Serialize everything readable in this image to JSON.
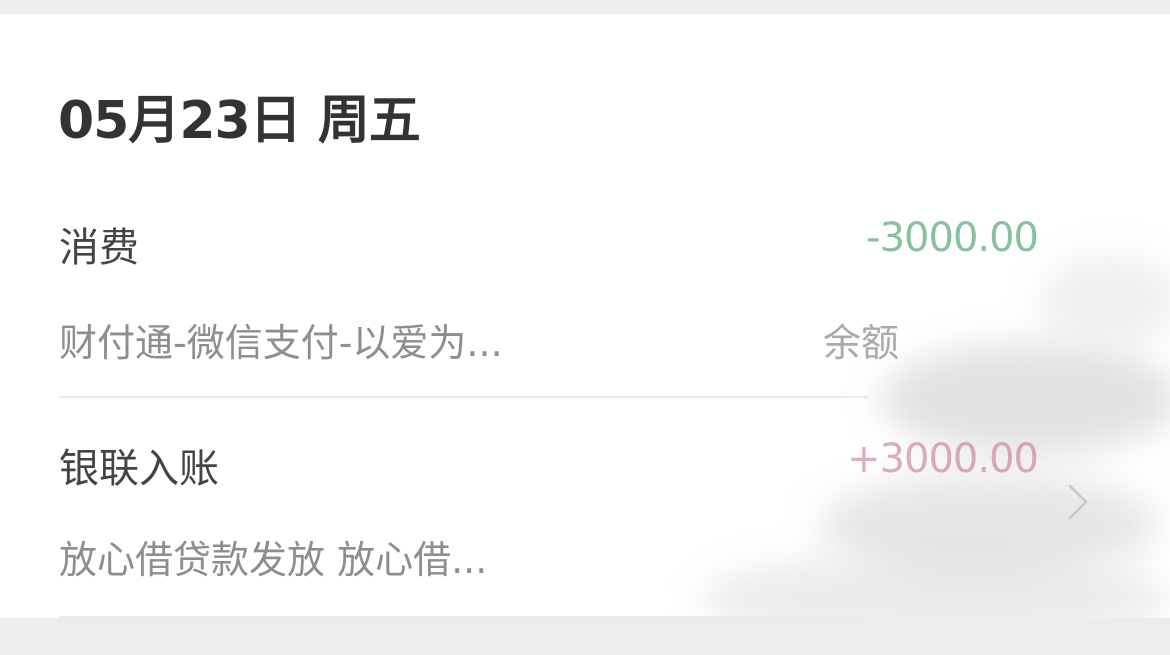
{
  "header": {
    "date": "05月23日 周五"
  },
  "transactions": [
    {
      "title": "消费",
      "amount": "-3000.00",
      "description": "财付通-微信支付-以爱为...",
      "balance_label": "余额"
    },
    {
      "title": "银联入账",
      "amount": "+3000.00",
      "description": "放心借贷款发放 放心借..."
    }
  ],
  "icons": {
    "row_arrow": "chevron-right-icon"
  },
  "colors": {
    "negative_amount": "#4aa06a",
    "positive_amount": "#c0607a",
    "background": "#ececec",
    "card": "#ffffff"
  }
}
